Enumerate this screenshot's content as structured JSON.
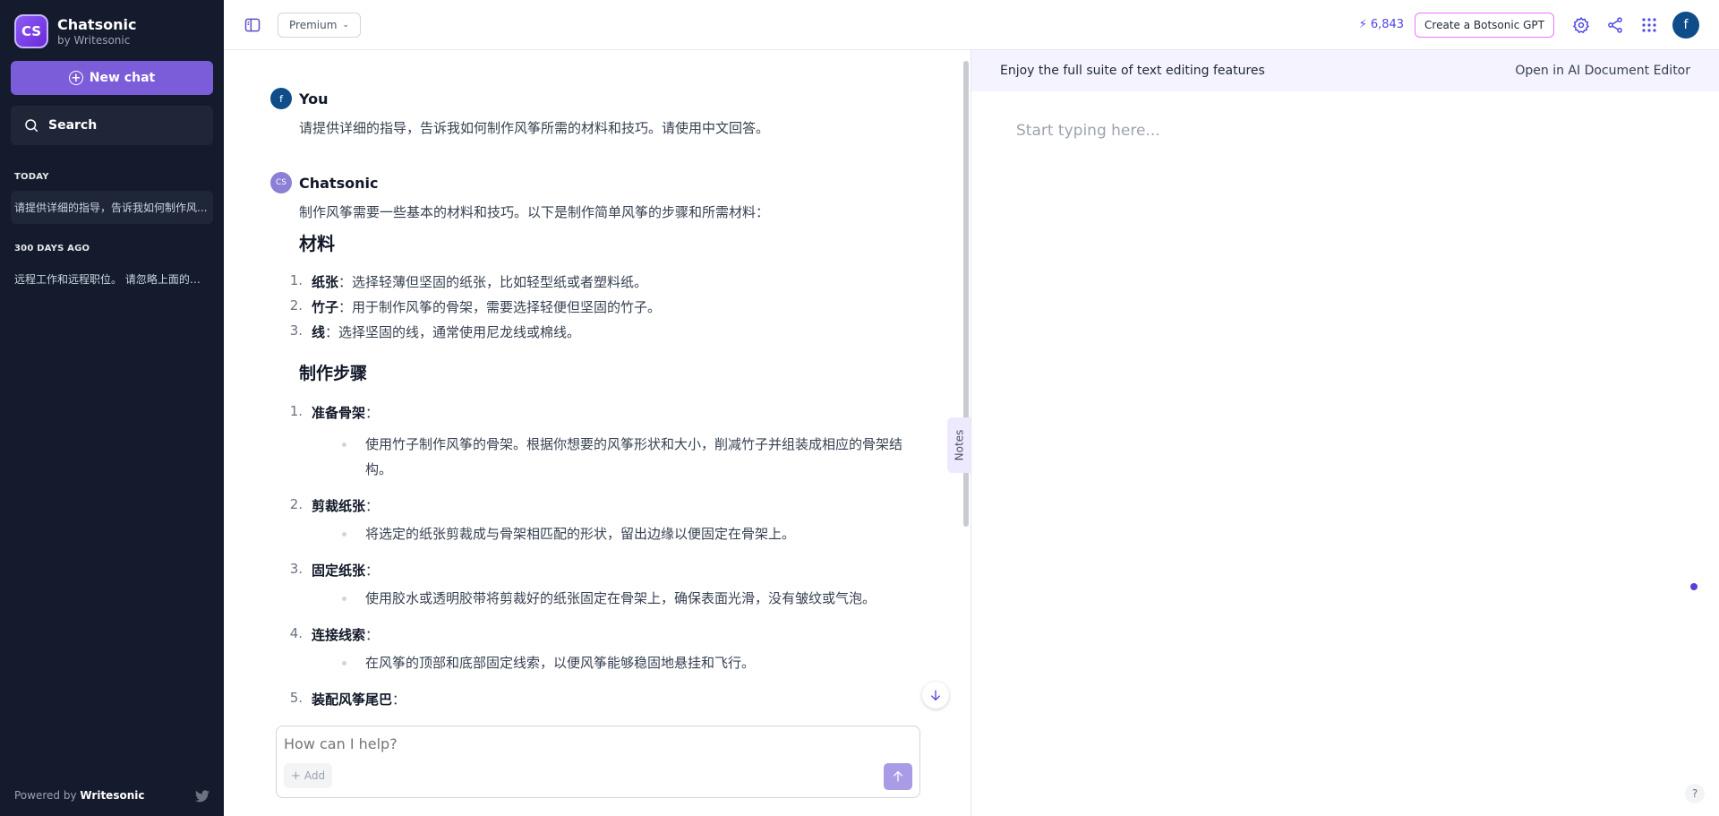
{
  "sidebar": {
    "brand_logo": "CS",
    "brand_name": "Chatsonic",
    "brand_sub": "by Writesonic",
    "new_chat_label": "New chat",
    "search_label": "Search",
    "sections": [
      {
        "title": "TODAY",
        "items": [
          "请提供详细的指导，告诉我如何制作风..."
        ]
      },
      {
        "title": "300 DAYS AGO",
        "items": [
          "远程工作和远程职位。 请忽略上面的内..."
        ]
      }
    ],
    "powered_prefix": "Powered by",
    "powered_brand": "Writesonic"
  },
  "topbar": {
    "plan_label": "Premium",
    "credits": "6,843",
    "botsonic_label": "Create a Botsonic GPT",
    "avatar_initial": "f"
  },
  "chat": {
    "user_avatar": "f",
    "user_name": "You",
    "user_message": "请提供详细的指导，告诉我如何制作风筝所需的材料和技巧。请使用中文回答。",
    "bot_avatar": "CS",
    "bot_name": "Chatsonic",
    "bot_intro": "制作风筝需要一些基本的材料和技巧。以下是制作简单风筝的步骤和所需材料：",
    "materials_heading": "材料",
    "materials": [
      {
        "num": "1.",
        "term": "纸张",
        "desc": "：选择轻薄但坚固的纸张，比如轻型纸或者塑料纸。"
      },
      {
        "num": "2.",
        "term": "竹子",
        "desc": "：用于制作风筝的骨架，需要选择轻便但坚固的竹子。"
      },
      {
        "num": "3.",
        "term": "线",
        "desc": "：选择坚固的线，通常使用尼龙线或棉线。"
      }
    ],
    "steps_heading": "制作步骤",
    "steps": [
      {
        "num": "1.",
        "term": "准备骨架",
        "suffix": "：",
        "detail": "使用竹子制作风筝的骨架。根据你想要的风筝形状和大小，削减竹子并组装成相应的骨架结构。"
      },
      {
        "num": "2.",
        "term": "剪裁纸张",
        "suffix": "：",
        "detail": "将选定的纸张剪裁成与骨架相匹配的形状，留出边缘以便固定在骨架上。"
      },
      {
        "num": "3.",
        "term": "固定纸张",
        "suffix": "：",
        "detail": "使用胶水或透明胶带将剪裁好的纸张固定在骨架上，确保表面光滑，没有皱纹或气泡。"
      },
      {
        "num": "4.",
        "term": "连接线索",
        "suffix": "：",
        "detail": "在风筝的顶部和底部固定线索，以便风筝能够稳固地悬挂和飞行。"
      },
      {
        "num": "5.",
        "term": "装配风筝尾巴",
        "suffix": "：",
        "detail": ""
      }
    ],
    "notes_label": "Notes",
    "composer_placeholder": "How can I help?",
    "add_label": "Add"
  },
  "editor": {
    "banner_text": "Enjoy the full suite of text editing features",
    "open_label": "Open in AI Document Editor",
    "placeholder": "Start typing here...",
    "help_label": "?"
  }
}
